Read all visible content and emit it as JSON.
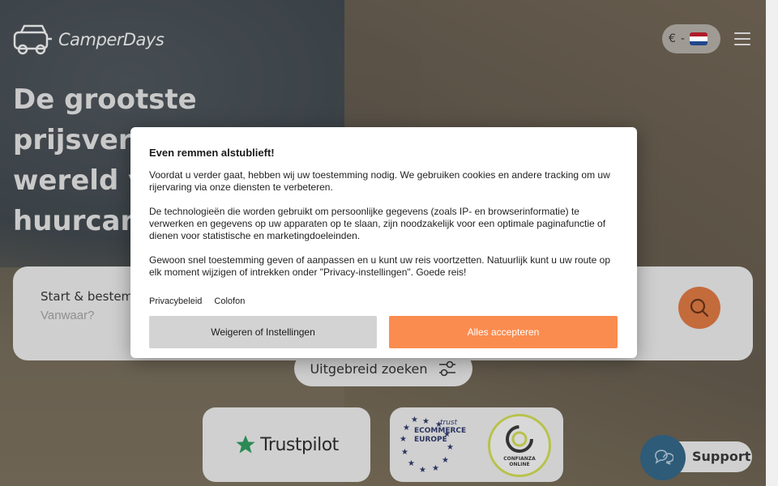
{
  "header": {
    "logo_text": "CamperDays",
    "currency_symbol": "€",
    "currency_separator": "-",
    "language_flag": "netherlands-flag"
  },
  "hero": {
    "title_lines": [
      "De grootste",
      "prijsverg",
      "wereld v",
      "huurcam"
    ]
  },
  "search": {
    "label": "Start & bestem",
    "placeholder": "Vanwaar?",
    "advanced_label": "Uitgebreid zoeken"
  },
  "badges": {
    "trustpilot": "Trustpilot",
    "ecommerce_trust": "trust",
    "ecommerce_line1": "ECOMMERCE",
    "ecommerce_line2": "EUROPE",
    "confianza_line1": "CONFIANZA",
    "confianza_line2": "ONLINE"
  },
  "support": {
    "label": "Support"
  },
  "cookie_modal": {
    "title": "Even remmen alstublieft!",
    "paragraph1": "Voordat u verder gaat, hebben wij uw toestemming nodig. We gebruiken cookies en andere tracking om uw rijervaring via onze diensten te verbeteren.",
    "paragraph2": "De technologieën die worden gebruikt om persoonlijke gegevens (zoals IP- en browserinformatie) te verwerken en gegevens op uw apparaten op te slaan, zijn noodzakelijk voor een optimale paginafunctie of dienen voor statistische en marketingdoeleinden.",
    "paragraph3": "Gewoon snel toestemming geven of aanpassen en u kunt uw reis voortzetten. Natuurlijk kunt u uw route op elk moment wijzigen of intrekken onder \"Privacy-instellingen\". Goede reis!",
    "link_privacy": "Privacybeleid",
    "link_colofon": "Colofon",
    "refuse_label": "Weigeren of Instellingen",
    "accept_label": "Alles accepteren"
  },
  "colors": {
    "accept": "#fb8c4f",
    "refuse": "#d3d3d3",
    "search_button": "#c46b3c",
    "support_circle": "#2e5b78"
  }
}
